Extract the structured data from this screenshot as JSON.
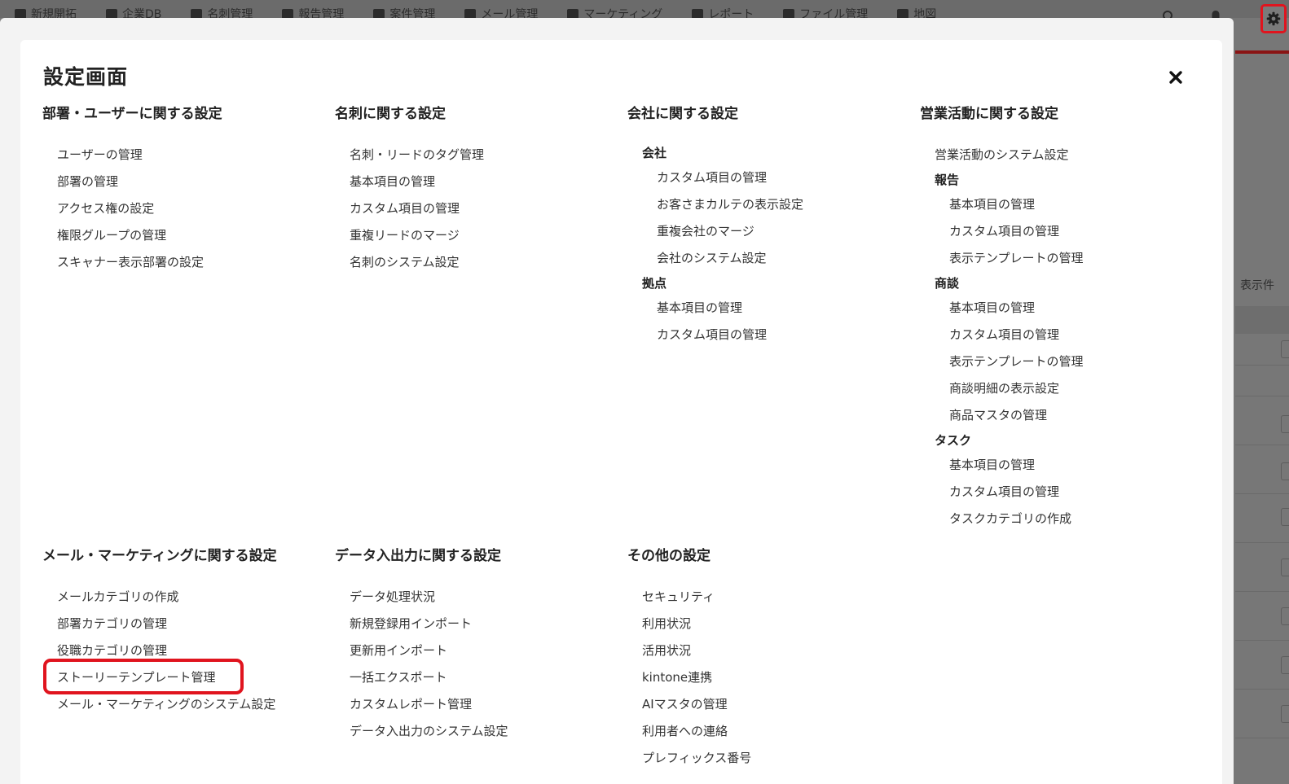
{
  "background": {
    "top_nav": [
      "新規開拓",
      "企業DB",
      "名刺管理",
      "報告管理",
      "案件管理",
      "メール管理",
      "マーケティング",
      "レポート",
      "ファイル管理",
      "地図"
    ],
    "right_text": "表示件"
  },
  "modal": {
    "title": "設定画面",
    "sections": {
      "users": {
        "title": "部署・ユーザーに関する設定",
        "items": [
          "ユーザーの管理",
          "部署の管理",
          "アクセス権の設定",
          "権限グループの管理",
          "スキャナー表示部署の設定"
        ]
      },
      "cards": {
        "title": "名刺に関する設定",
        "items": [
          "名刺・リードのタグ管理",
          "基本項目の管理",
          "カスタム項目の管理",
          "重複リードのマージ",
          "名刺のシステム設定"
        ]
      },
      "company": {
        "title": "会社に関する設定",
        "company_head": "会社",
        "company_items": [
          "カスタム項目の管理",
          "お客さまカルテの表示設定",
          "重複会社のマージ",
          "会社のシステム設定"
        ],
        "base_head": "拠点",
        "base_items": [
          "基本項目の管理",
          "カスタム項目の管理"
        ]
      },
      "sales": {
        "title": "営業活動に関する設定",
        "system_item": "営業活動のシステム設定",
        "report_head": "報告",
        "report_items": [
          "基本項目の管理",
          "カスタム項目の管理",
          "表示テンプレートの管理"
        ],
        "deal_head": "商談",
        "deal_items": [
          "基本項目の管理",
          "カスタム項目の管理",
          "表示テンプレートの管理",
          "商談明細の表示設定",
          "商品マスタの管理"
        ],
        "task_head": "タスク",
        "task_items": [
          "基本項目の管理",
          "カスタム項目の管理",
          "タスクカテゴリの作成"
        ]
      },
      "mail": {
        "title": "メール・マーケティングに関する設定",
        "items": [
          "メールカテゴリの作成",
          "部署カテゴリの管理",
          "役職カテゴリの管理",
          "ストーリーテンプレート管理",
          "メール・マーケティングのシステム設定"
        ]
      },
      "data": {
        "title": "データ入出力に関する設定",
        "items": [
          "データ処理状況",
          "新規登録用インポート",
          "更新用インポート",
          "一括エクスポート",
          "カスタムレポート管理",
          "データ入出力のシステム設定"
        ]
      },
      "other": {
        "title": "その他の設定",
        "items": [
          "セキュリティ",
          "利用状況",
          "活用状況",
          "kintone連携",
          "AIマスタの管理",
          "利用者への連絡",
          "プレフィックス番号"
        ]
      }
    }
  },
  "icons": {
    "settings": "gear-icon",
    "close": "close-icon",
    "search": "search-icon",
    "notifications": "bell-icon"
  },
  "colors": {
    "highlight": "#e0141e",
    "overlay": "#7a7a7a",
    "modal_bg": "#ffffff"
  }
}
